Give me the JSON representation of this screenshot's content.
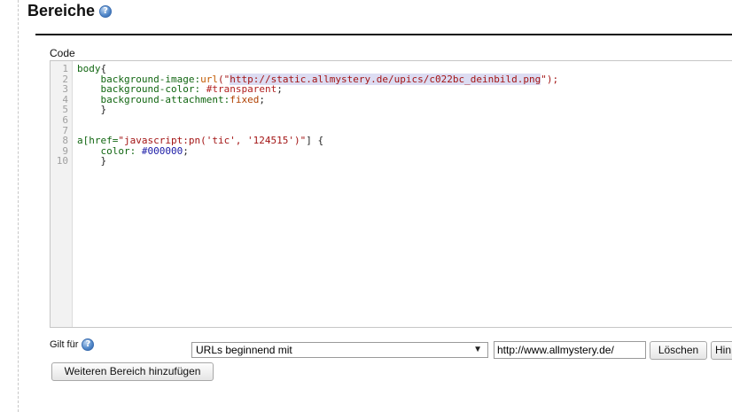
{
  "page": {
    "title": "Bereiche"
  },
  "code": {
    "label": "Code",
    "line_numbers": [
      "1",
      "2",
      "3",
      "4",
      "5",
      "6",
      "7",
      "8",
      "9",
      "10"
    ],
    "lines": {
      "l1_selector": "body",
      "l1_brace": "{",
      "l2_prop": "background-image:",
      "l2_fn": "url",
      "l2_open": "(\"",
      "l2_url": "http://static.allmystery.de/upics/c022bc_deinbild.png",
      "l2_close": "\");",
      "l3_prop": "background-color: ",
      "l3_val": "#transparent",
      "l3_end": ";",
      "l4_prop": "background-attachment:",
      "l4_val": "fixed",
      "l4_end": ";",
      "l5": "}",
      "l8_sel": "a[href=",
      "l8_str": "\"javascript:pn('tic', '124515')\"",
      "l8_end": "] {",
      "l9_prop": "color: ",
      "l9_val": "#000000",
      "l9_end": ";",
      "l10": "}"
    }
  },
  "scope": {
    "label": "Gilt für",
    "select_value": "URLs beginnend mit",
    "url_value": "http://www.allmystery.de/",
    "delete_button": "Löschen",
    "next_button": "Hin",
    "add_button": "Weiteren Bereich hinzufügen"
  },
  "icons": {
    "help": "help-icon"
  },
  "colors": {
    "accent": "#4f86c8",
    "rule": "#111111"
  }
}
